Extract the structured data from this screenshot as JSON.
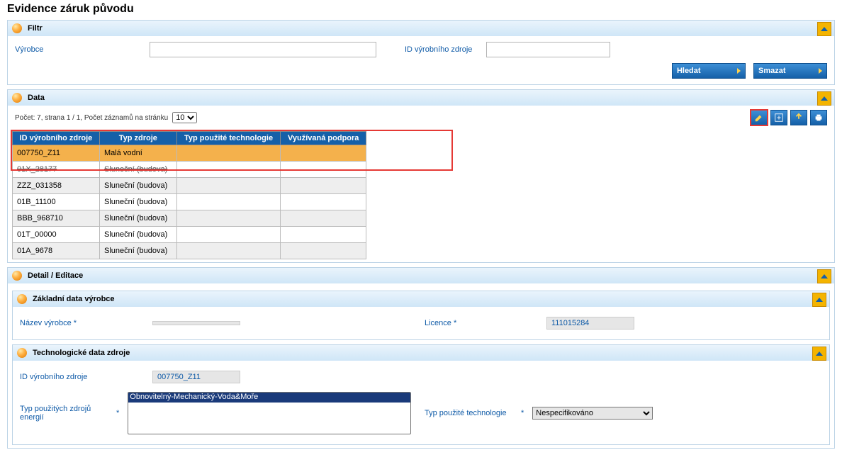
{
  "page_title": "Evidence záruk původu",
  "filtr": {
    "title": "Filtr",
    "vyrobce_label": "Výrobce",
    "vyrobce_value": "",
    "id_zdroje_label": "ID výrobního zdroje",
    "id_zdroje_value": "",
    "hledat": "Hledat",
    "smazat": "Smazat"
  },
  "data": {
    "title": "Data",
    "pager_text": "Počet: 7, strana 1 / 1, Počet záznamů na stránku",
    "page_size": "10",
    "columns": [
      "ID výrobního zdroje",
      "Typ zdroje",
      "Typ použité technologie",
      "Využívaná podpora"
    ],
    "rows": [
      {
        "id": "007750_Z11",
        "typ": "Malá vodní",
        "tech": "",
        "podpora": "",
        "sel": true
      },
      {
        "id": "01X_28177",
        "typ": "Sluneční (budova)",
        "tech": "",
        "podpora": "",
        "strike": true
      },
      {
        "id": "ZZZ_031358",
        "typ": "Sluneční (budova)",
        "tech": "",
        "podpora": ""
      },
      {
        "id": "01B_11100",
        "typ": "Sluneční (budova)",
        "tech": "",
        "podpora": ""
      },
      {
        "id": "BBB_968710",
        "typ": "Sluneční (budova)",
        "tech": "",
        "podpora": ""
      },
      {
        "id": "01T_00000",
        "typ": "Sluneční (budova)",
        "tech": "",
        "podpora": ""
      },
      {
        "id": "01A_9678",
        "typ": "Sluneční (budova)",
        "tech": "",
        "podpora": ""
      }
    ]
  },
  "detail": {
    "title": "Detail / Editace",
    "zakladni": {
      "title": "Základní data výrobce",
      "nazev_label": "Název výrobce *",
      "nazev_value": "",
      "licence_label": "Licence *",
      "licence_value": "111015284"
    },
    "tech": {
      "title": "Technologické data zdroje",
      "id_label": "ID výrobního zdroje",
      "id_value": "007750_Z11",
      "typ_energii_label": "Typ použitých zdrojů energií",
      "typ_energii_req": "*",
      "typ_energii_option": "Obnovitelný-Mechanický-Voda&Moře",
      "typ_tech_label": "Typ použité technologie",
      "typ_tech_req": "*",
      "typ_tech_value": "Nespecifikováno"
    }
  }
}
